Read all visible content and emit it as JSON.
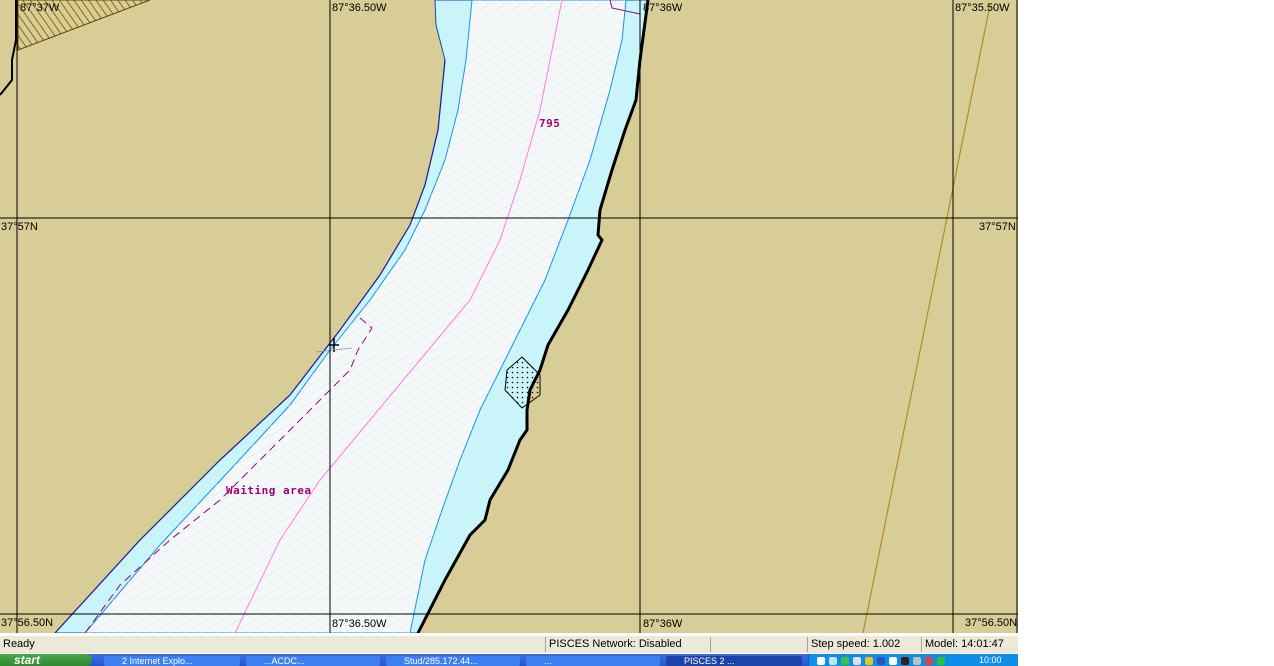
{
  "map": {
    "coords_top": [
      "87°37W",
      "87°36.50W",
      "87°36W",
      "87°35.50W"
    ],
    "coords_bottom": [
      "37°56.50N",
      "87°36.50W",
      "87°36W",
      "37°56.50N"
    ],
    "lat_left": "37°57N",
    "lat_right": "37°57N",
    "depth_label": "795",
    "area_label": "Waiting area",
    "colors": {
      "land": "#d8cd96",
      "shallow_water": "#c8f4fa",
      "deep_water": "#f4f8f8",
      "channel_line": "#ff7ce8",
      "waiting_area": "#a0007a",
      "shoreline": "#000000",
      "cable_line": "#b48c1e"
    }
  },
  "status": {
    "ready": "Ready",
    "network": "PISCES Network: Disabled",
    "empty": "",
    "step_speed": "Step speed: 1.002",
    "model": "Model: 14:01:47"
  },
  "taskbar": {
    "start": "start",
    "buttons": [
      "2 Internet Explo...",
      "...ACDC...",
      "Stud/285.172.44...",
      "...",
      "PISCES 2 ..."
    ],
    "clock": "10:00"
  }
}
